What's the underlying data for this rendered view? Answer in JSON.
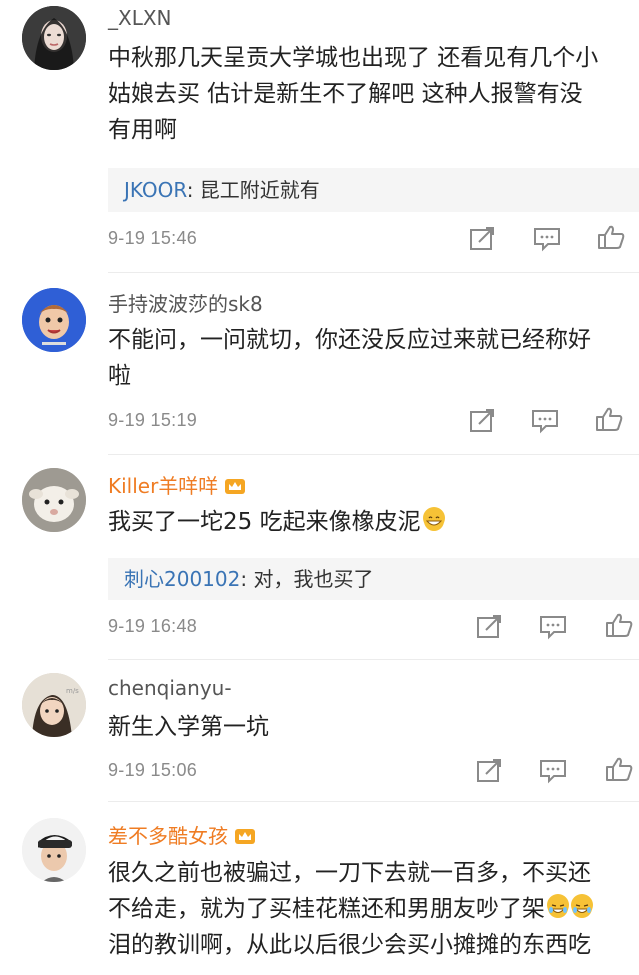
{
  "comments": [
    {
      "username": "_XLXN",
      "text": [
        "中秋那几天呈贡大学城也出现了 还看见有几个小",
        "姑娘去买 估计是新生不了解吧 这种人报警有没",
        "有用啊"
      ],
      "reply": {
        "name": "JKOOR",
        "text": ": 昆工附近就有"
      },
      "time": "9-19 15:46"
    },
    {
      "username": "手持波波莎的sk8",
      "text": [
        "不能问，一问就切，你还没反应过来就已经称好",
        "啦"
      ],
      "time": "9-19 15:19"
    },
    {
      "username": "Killer羊咩咩",
      "text": [
        "我买了一坨25 吃起来像橡皮泥"
      ],
      "reply": {
        "name": "刺心200102",
        "text": ": 对，我也买了"
      },
      "time": "9-19 16:48"
    },
    {
      "username": "chenqianyu-",
      "text": [
        "新生入学第一坑"
      ],
      "time": "9-19 15:06"
    },
    {
      "username": "差不多酷女孩",
      "text": [
        "很久之前也被骗过，一刀下去就一百多，不买还",
        "不给走，就为了买桂花糕还和男朋友吵了架",
        "泪的教训啊，从此以后很少会买小摊摊的东西吃"
      ]
    }
  ],
  "icons": [
    "share-icon",
    "comment-icon",
    "like-icon",
    "crown-badge-icon",
    "grin-emoji-icon",
    "laugh-cry-emoji-icon"
  ],
  "colors": {
    "username_vip": "#ef7c23",
    "reply_name": "#3a74b5",
    "time": "#8a8a8a",
    "reply_bg": "#f5f5f5"
  }
}
